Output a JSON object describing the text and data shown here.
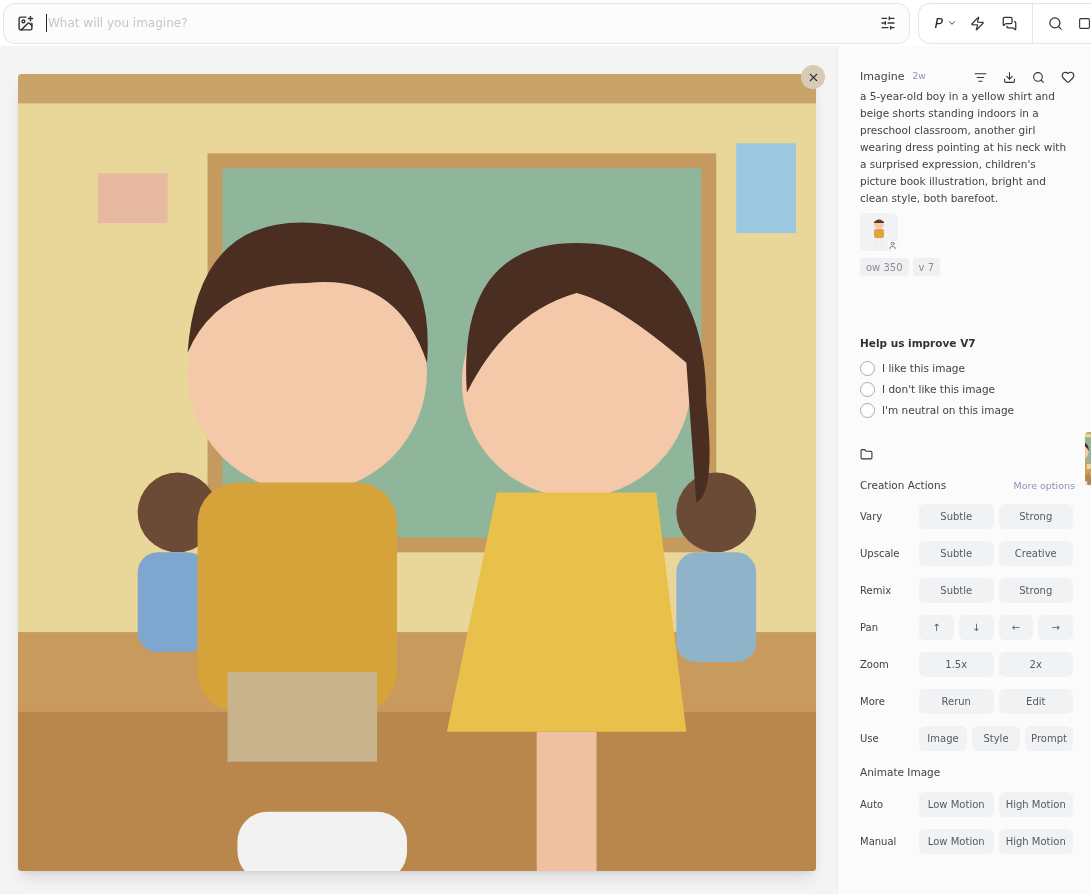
{
  "prompt_bar": {
    "placeholder": "What will you imagine?"
  },
  "toolbar": {
    "personalize": "P"
  },
  "details": {
    "title": "Imagine",
    "age": "2w",
    "prompt": "a 5-year-old boy in a yellow shirt and beige shorts standing indoors in a preschool classroom, another girl wearing dress pointing at his neck with a surprised expression, children's picture book illustration, bright and clean style, both barefoot.",
    "tags": [
      "ow 350",
      "v 7"
    ]
  },
  "feedback": {
    "title": "Help us improve V7",
    "options": [
      {
        "label": "I like this image",
        "selected": false
      },
      {
        "label": "I don't like this image",
        "selected": false
      },
      {
        "label": "I'm neutral on this image",
        "selected": false
      }
    ]
  },
  "creation_actions": {
    "title": "Creation Actions",
    "more": "More options",
    "rows": [
      {
        "label": "Vary",
        "buttons": [
          "Subtle",
          "Strong"
        ]
      },
      {
        "label": "Upscale",
        "buttons": [
          "Subtle",
          "Creative"
        ]
      },
      {
        "label": "Remix",
        "buttons": [
          "Subtle",
          "Strong"
        ]
      },
      {
        "label": "Pan",
        "buttons": [
          "↑",
          "↓",
          "←",
          "→"
        ]
      },
      {
        "label": "Zoom",
        "buttons": [
          "1.5x",
          "2x"
        ]
      },
      {
        "label": "More",
        "buttons": [
          "Rerun",
          "Edit"
        ]
      },
      {
        "label": "Use",
        "buttons": [
          "Image",
          "Style",
          "Prompt"
        ]
      }
    ]
  },
  "animate": {
    "title": "Animate Image",
    "rows": [
      {
        "label": "Auto",
        "buttons": [
          "Low Motion",
          "High Motion"
        ]
      },
      {
        "label": "Manual",
        "buttons": [
          "Low Motion",
          "High Motion"
        ]
      }
    ]
  }
}
